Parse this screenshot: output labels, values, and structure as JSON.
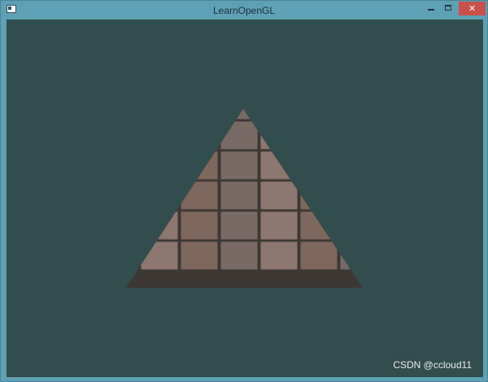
{
  "window": {
    "title": "LearnOpenGL",
    "close_glyph": "✕"
  },
  "scene": {
    "clear_color": "#324d4d",
    "texture": "brick-pavement",
    "brick_colors": [
      "#7a6a66",
      "#6e6258",
      "#8c6a62",
      "#5e5a56",
      "#8e7770",
      "#6a706a",
      "#9b736b",
      "#5c5652",
      "#7f675d",
      "#8d6e66",
      "#66655e",
      "#7b5c55"
    ],
    "mortar_color": "#3e3834"
  },
  "watermark": {
    "text": "CSDN @ccloud11"
  }
}
